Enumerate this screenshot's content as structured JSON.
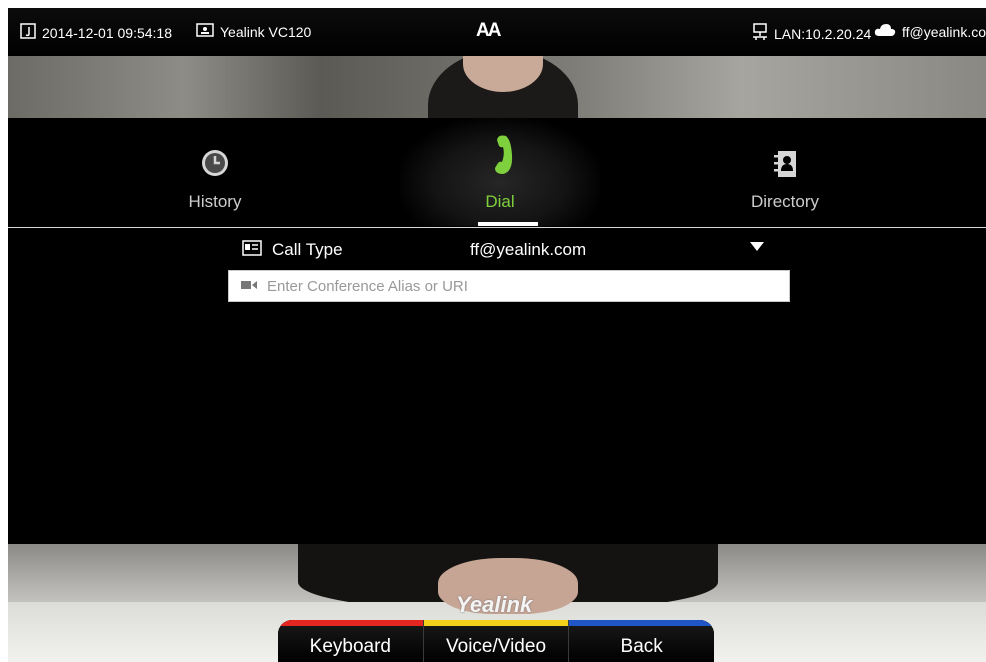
{
  "statusbar": {
    "datetime": "2014-12-01 09:54:18",
    "device_name": "Yealink VC120",
    "font_toggle": "AA",
    "lan": "LAN:10.2.20.24",
    "account": "ff@yealink.com",
    "icons": [
      "calendar-icon",
      "monitor-icon",
      "network-icon",
      "cloud-icon"
    ]
  },
  "tabs": [
    {
      "label": "History",
      "icon": "clock-icon",
      "active": false
    },
    {
      "label": "Dial",
      "icon": "phone-handset-icon",
      "active": true
    },
    {
      "label": "Directory",
      "icon": "address-book-icon",
      "active": false
    }
  ],
  "dial_form": {
    "call_type_label": "Call Type",
    "call_type_value": "ff@yealink.com",
    "input_placeholder": "Enter Conference Alias or URI",
    "input_value": ""
  },
  "video": {
    "brand_watermark": "Yealink"
  },
  "softkeys": [
    {
      "label": "Keyboard",
      "color": "#e3261f"
    },
    {
      "label": "Voice/Video",
      "color": "#f3d11b"
    },
    {
      "label": "Back",
      "color": "#1f55c4"
    }
  ],
  "colors": {
    "accent_active": "#7ed13c",
    "background": "#000000"
  }
}
